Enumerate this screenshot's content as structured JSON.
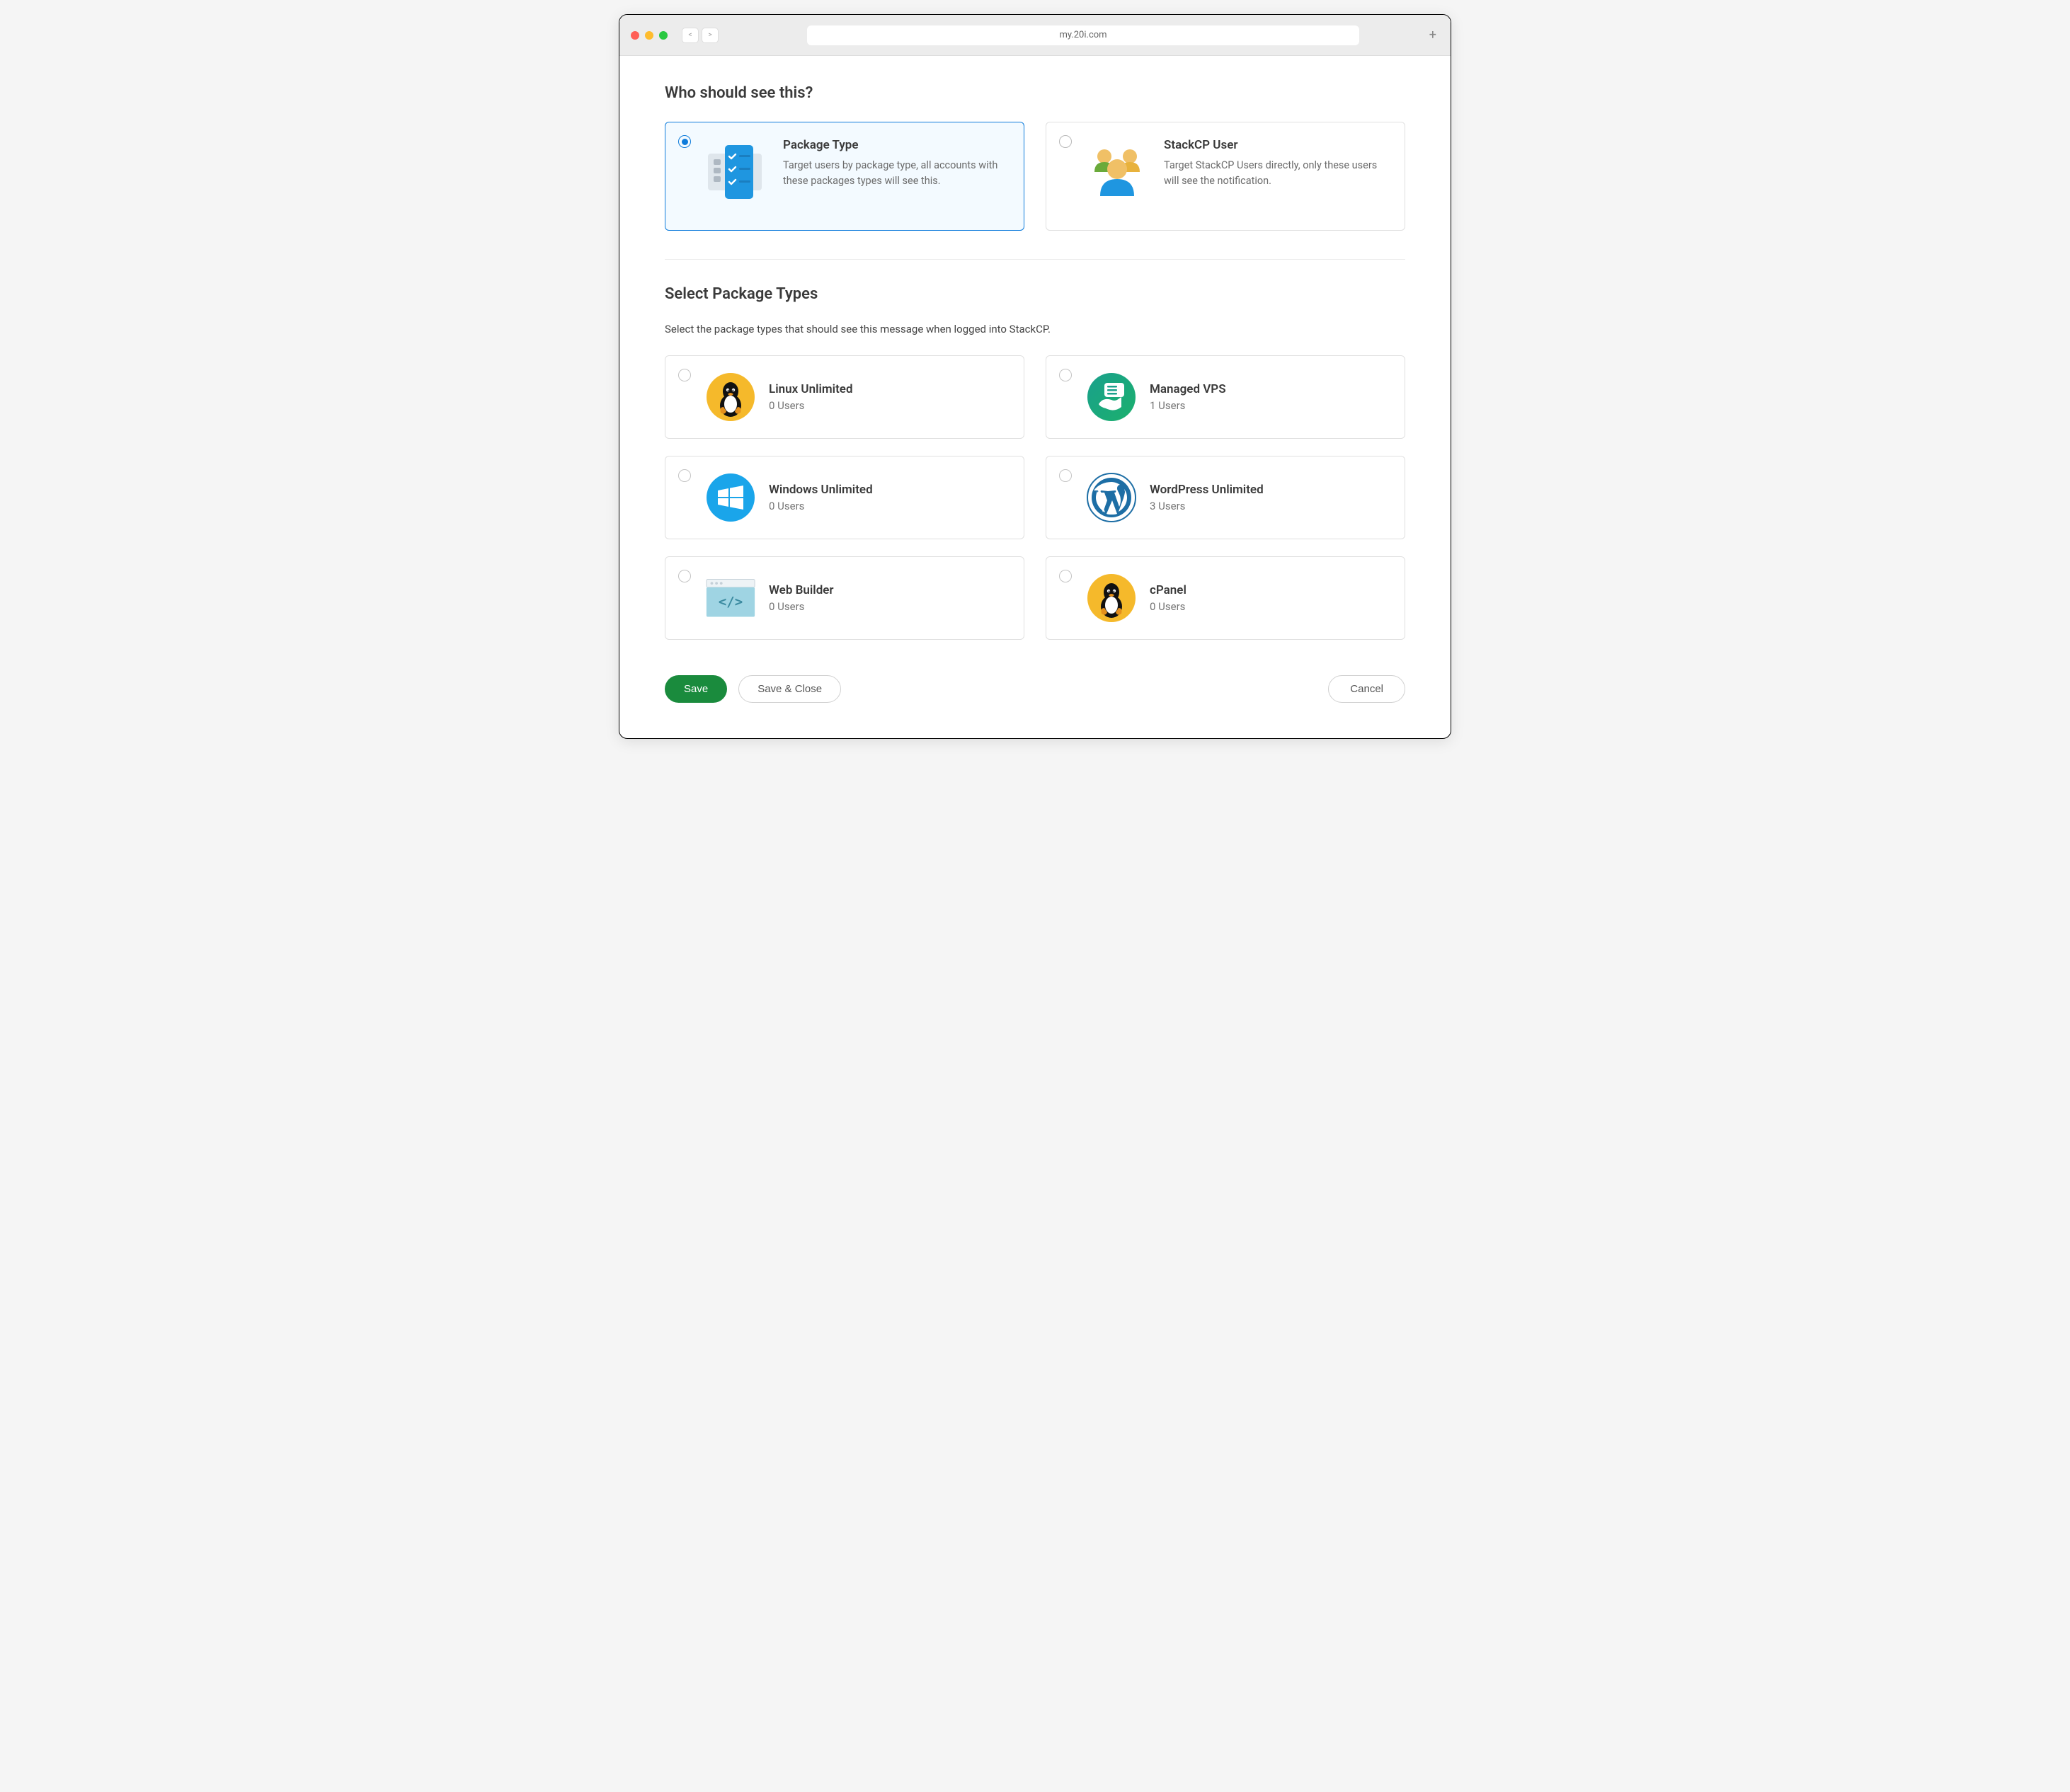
{
  "browser": {
    "url": "my.20i.com",
    "back": "<",
    "forward": ">",
    "newtab": "+"
  },
  "section1": {
    "title": "Who should see this?",
    "options": [
      {
        "title": "Package Type",
        "desc": "Target users by package type, all accounts with these packages types will see this.",
        "selected": true
      },
      {
        "title": "StackCP User",
        "desc": "Target StackCP Users directly, only these users will see the notification.",
        "selected": false
      }
    ]
  },
  "section2": {
    "title": "Select Package Types",
    "desc": "Select the package types that should see this message when logged into StackCP.",
    "packages": [
      {
        "title": "Linux Unlimited",
        "users": "0 Users"
      },
      {
        "title": "Managed VPS",
        "users": "1 Users"
      },
      {
        "title": "Windows Unlimited",
        "users": "0 Users"
      },
      {
        "title": "WordPress Unlimited",
        "users": "3 Users"
      },
      {
        "title": "Web Builder",
        "users": "0 Users"
      },
      {
        "title": "cPanel",
        "users": "0 Users"
      }
    ]
  },
  "footer": {
    "save": "Save",
    "save_close": "Save & Close",
    "cancel": "Cancel"
  }
}
